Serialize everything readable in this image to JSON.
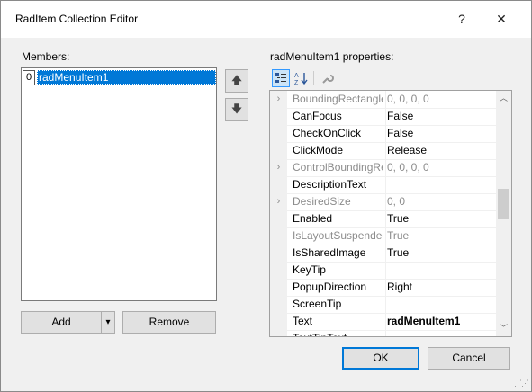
{
  "window": {
    "title": "RadItem Collection Editor",
    "help_label": "?",
    "close_label": "✕"
  },
  "members": {
    "label": "Members:",
    "items": [
      {
        "index": "0",
        "name": "radMenuItem1"
      }
    ],
    "move_up_label": "🡅",
    "move_down_label": "🡇",
    "add_label": "Add",
    "add_dropdown_label": "▾",
    "remove_label": "Remove"
  },
  "properties": {
    "label": "radMenuItem1 properties:",
    "toolbar": {
      "categorized_icon": "categorized-icon",
      "alphabetical_icon": "alphabetical-icon",
      "property_pages_icon": "wrench-icon"
    },
    "rows": [
      {
        "name": "BoundingRectangle",
        "value": "0, 0, 0, 0",
        "expandable": true,
        "disabled": true,
        "bold": false
      },
      {
        "name": "CanFocus",
        "value": "False",
        "expandable": false,
        "disabled": false,
        "bold": false
      },
      {
        "name": "CheckOnClick",
        "value": "False",
        "expandable": false,
        "disabled": false,
        "bold": false
      },
      {
        "name": "ClickMode",
        "value": "Release",
        "expandable": false,
        "disabled": false,
        "bold": false
      },
      {
        "name": "ControlBoundingRectangle",
        "value": "0, 0, 0, 0",
        "expandable": true,
        "disabled": true,
        "bold": false
      },
      {
        "name": "DescriptionText",
        "value": "",
        "expandable": false,
        "disabled": false,
        "bold": false
      },
      {
        "name": "DesiredSize",
        "value": "0, 0",
        "expandable": true,
        "disabled": true,
        "bold": false
      },
      {
        "name": "Enabled",
        "value": "True",
        "expandable": false,
        "disabled": false,
        "bold": false
      },
      {
        "name": "IsLayoutSuspended",
        "value": "True",
        "expandable": false,
        "disabled": true,
        "bold": false
      },
      {
        "name": "IsSharedImage",
        "value": "True",
        "expandable": false,
        "disabled": false,
        "bold": false
      },
      {
        "name": "KeyTip",
        "value": "",
        "expandable": false,
        "disabled": false,
        "bold": false
      },
      {
        "name": "PopupDirection",
        "value": "Right",
        "expandable": false,
        "disabled": false,
        "bold": false
      },
      {
        "name": "ScreenTip",
        "value": "",
        "expandable": false,
        "disabled": false,
        "bold": false
      },
      {
        "name": "Text",
        "value": "radMenuItem1",
        "expandable": false,
        "disabled": false,
        "bold": true
      },
      {
        "name": "TextTipText",
        "value": "",
        "expandable": false,
        "disabled": false,
        "bold": false
      }
    ]
  },
  "footer": {
    "ok_label": "OK",
    "cancel_label": "Cancel"
  },
  "colors": {
    "selection": "#0078d7",
    "ok_border": "#0078d7",
    "dialog_bg": "#f0f0f0"
  }
}
